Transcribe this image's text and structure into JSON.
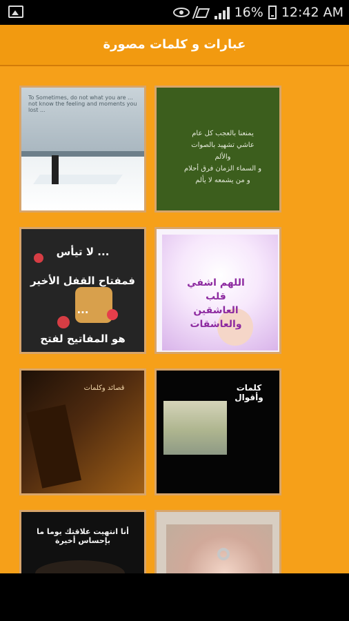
{
  "status": {
    "battery": "16%",
    "time": "12:42 AM"
  },
  "app": {
    "title": "عبارات و كلمات مصورة"
  },
  "tiles": [
    {
      "name": "snow-pier-image",
      "text": "To Sometimes, do not what you are ... not know the feeling and moments you lost ..."
    },
    {
      "name": "green-quote-image",
      "text": "يمنعنا بالعجب كل عام\nعاشي تشهيد بالصوات والألم\nو السماء الزمان فرق أحلام\nو من يشمعه لا يألم"
    },
    {
      "name": "dice-quote-image",
      "text": "لا تيأس ...\nفمفتاح القفل الأخير ...\nهو المفاتيح لفتح الباب"
    },
    {
      "name": "prayer-baby-image",
      "text": "اللهم اشفي قلب العاشقين والعاشقات"
    },
    {
      "name": "sunset-poem-image",
      "text": "قصائد وكلمات"
    },
    {
      "name": "sea-words-image",
      "text": "كلمات وأقوال"
    },
    {
      "name": "dark-quote-image",
      "text": "أنا انتهيت علاقتك يوما ما بإحساس أخيرة"
    },
    {
      "name": "rings-hands-image",
      "text": ""
    }
  ]
}
